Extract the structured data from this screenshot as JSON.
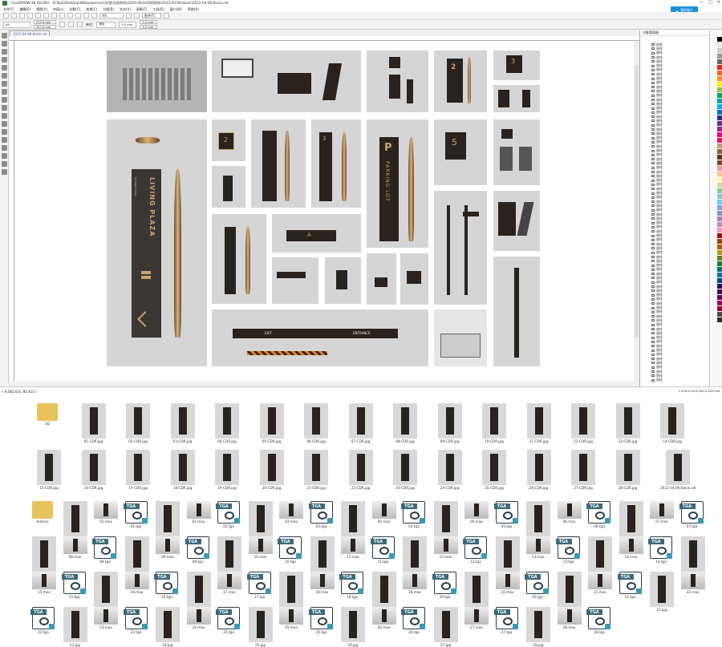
{
  "window": {
    "title": "CorelDRAW X8 (64-Bit) - D:\\Bao\\Desktop\\Wallpaper\\com导视\\导视系统\\2020-08-03导视系统\\2022-04-06-black\\2022-04-06-black.cdr",
    "controls": [
      "—",
      "□",
      "✕"
    ]
  },
  "menu": [
    "文件(F)",
    "编辑(E)",
    "视图(V)",
    "布局(L)",
    "对象(C)",
    "效果(C)",
    "位图(B)",
    "文本(X)",
    "表格(T)",
    "工具(O)",
    "窗口(W)",
    "帮助(H)"
  ],
  "login_button": "我的账户",
  "toolbar": {
    "zoom": "4%",
    "snap": "贴齐(T)"
  },
  "propbar": {
    "page_size": "A4",
    "width": "210.0 mm",
    "height": "297.0 mm",
    "units_label": "单位:",
    "units": "毫米",
    "nudge": "5.0 mm",
    "dup_x": "5.0 mm",
    "dup_y": "5.0 mm"
  },
  "document_tab": "2022-04-06-black.cdr",
  "panel": {
    "title": "对象管理器",
    "layer_name": "曲线"
  },
  "status": {
    "coords": "( 9,582.631, 85.422 )",
    "fill_info": "C:0 M:0 Y:0 K:100 0.200 mm"
  },
  "canvas_text": {
    "living_plaza": "LIVING PLAZA",
    "international": "INTERNATIONAL",
    "parking_lot": "PARKING LOT",
    "p": "P",
    "floor_2": "2",
    "floor_3": "3",
    "floor_5": "5",
    "exit": "EXIT",
    "entrance": "ENTRANCE",
    "a": "A"
  },
  "cdr_files": [
    "3D",
    "01-CDR.jpg",
    "02-CDR.jpg",
    "03-CDR.jpg",
    "04-CDR.jpg",
    "05-CDR.jpg",
    "06-CDR.jpg",
    "07-CDR.jpg",
    "08-CDR.jpg",
    "09-CDR.jpg",
    "10-CDR.jpg",
    "11-CDR.jpg",
    "12-CDR.jpg",
    "13-CDR.jpg",
    "14-CDR.jpg",
    "15-CDR.jpg",
    "16-CDR.jpg",
    "17-CDR.jpg",
    "18-CDR.jpg",
    "19-CDR.jpg",
    "20-CDR.jpg",
    "21-CDR.jpg",
    "22-CDR.jpg",
    "23-CDR.jpg",
    "24-CDR.jpg",
    "25-CDR.jpg",
    "26-CDR.jpg",
    "27-CDR.jpg",
    "28-CDR.jpg",
    "2022-04-06-black.cdr"
  ],
  "max_files": [
    "texture",
    "01.jpg",
    "01.max",
    "01.tga",
    "02.jpg",
    "02.max",
    "02.tga",
    "03.jpg",
    "03.max",
    "03.tga",
    "04.jpg",
    "04.max",
    "04.tga",
    "05.jpg",
    "05.max",
    "05.tga",
    "06.jpg",
    "06.max",
    "06.tga",
    "07.jpg",
    "07.max",
    "07.tga",
    "08.jpg",
    "08.max",
    "08.tga",
    "09.jpg",
    "09.max",
    "09.tga",
    "10.jpg",
    "10.max",
    "10.tga",
    "11.jpg",
    "11.max",
    "11.tga",
    "12.jpg",
    "12.max",
    "12.tga",
    "13.jpg",
    "13.max",
    "13.tga",
    "14.jpg",
    "14.max",
    "14.tga",
    "15.jpg",
    "15.max",
    "15.tga",
    "16.jpg",
    "16.max",
    "16.tga",
    "17.jpg",
    "17.max",
    "17.tga",
    "18.jpg",
    "18.max",
    "18.tga",
    "19.jpg",
    "19.max",
    "19.tga",
    "20.jpg",
    "20.max",
    "20.tga",
    "21.jpg",
    "21.max",
    "21.tga",
    "22.jpg",
    "22.max",
    "22.tga",
    "23.jpg",
    "23.max",
    "23.tga",
    "24.jpg",
    "24.max",
    "24.tga",
    "25.jpg",
    "25.max",
    "25.tga",
    "26.jpg",
    "26.max",
    "26.tga",
    "27.jpg",
    "27.max",
    "27.tga",
    "28.jpg",
    "28.max",
    "28.tga"
  ],
  "colors": {
    "accent": "#1a8fe0",
    "sign_dark": "#2a221d",
    "palette": [
      "#ffffff",
      "#000000",
      "#e6e6e6",
      "#cccccc",
      "#999999",
      "#666666",
      "#e8261c",
      "#f26522",
      "#f7941d",
      "#fff200",
      "#8dc63f",
      "#00a651",
      "#00a99d",
      "#00aeef",
      "#0072bc",
      "#2e3192",
      "#662d91",
      "#92278f",
      "#ec008c",
      "#ed145b",
      "#c69c6d",
      "#8c6239",
      "#603913",
      "#754c24",
      "#f5989d",
      "#fdc689",
      "#fff799",
      "#c4df9b",
      "#82ca9c",
      "#7accc8",
      "#6dcff6",
      "#7da7d9",
      "#8393ca",
      "#a186be",
      "#bd8cbf",
      "#f49ac1",
      "#9e0b0f",
      "#a0410d",
      "#a36209",
      "#aba000",
      "#598527",
      "#197b30",
      "#00746b",
      "#0076a3",
      "#004a80",
      "#1b1464",
      "#440e62",
      "#630460",
      "#9e005d",
      "#9e0039",
      "#534741",
      "#362f2d"
    ]
  }
}
